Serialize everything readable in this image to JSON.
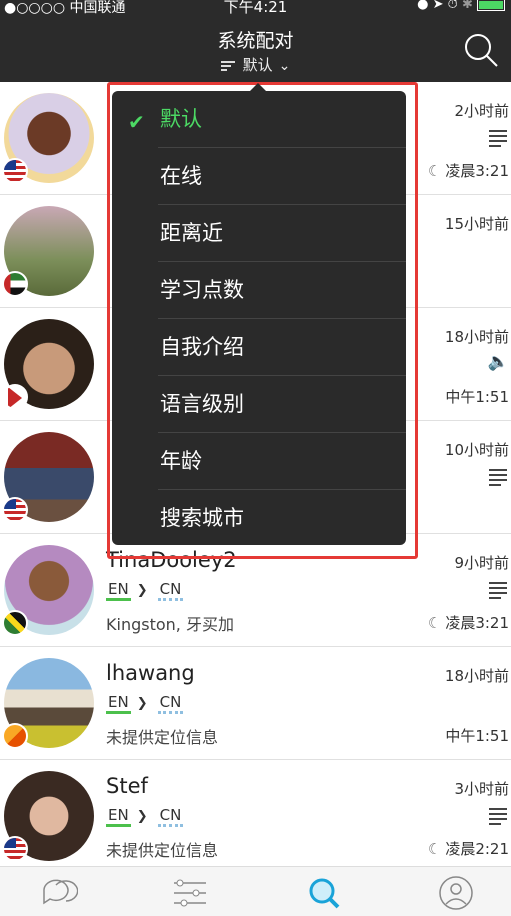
{
  "status_bar": {
    "carrier": "●○○○○ 中国联通",
    "time": "下午4:21",
    "icons": [
      "orientation-lock-icon",
      "location-icon",
      "alarm-icon",
      "bluetooth-icon",
      "battery-icon"
    ]
  },
  "nav": {
    "title": "系统配对",
    "sort_label": "默认",
    "search_icon": "search-icon"
  },
  "dropdown": {
    "selected": "默认",
    "options": [
      "默认",
      "在线",
      "距离近",
      "学习点数",
      "自我介绍",
      "语言级别",
      "年龄",
      "搜索城市"
    ]
  },
  "users": [
    {
      "when": "2小时前",
      "local_time": "凌晨3:21",
      "flag": "US",
      "icon": "note-icon"
    },
    {
      "when": "15小时前",
      "local_time": "",
      "flag": "AE",
      "icon": ""
    },
    {
      "when": "18小时前",
      "local_time": "中午1:51",
      "flag": "NP",
      "icon": "speaker-icon"
    },
    {
      "when": "10小时前",
      "local_time": "",
      "flag": "US",
      "icon": "note-icon"
    },
    {
      "name": "TinaDooley2",
      "native": "EN",
      "learning": "CN",
      "location": "Kingston, 牙买加",
      "when": "9小时前",
      "local_time": "凌晨3:21",
      "flag": "JM",
      "icon": "note-icon"
    },
    {
      "name": "lhawang",
      "native": "EN",
      "learning": "CN",
      "location": "未提供定位信息",
      "when": "18小时前",
      "local_time": "中午1:51",
      "flag": "BT",
      "icon": ""
    },
    {
      "name": "Stef",
      "native": "EN",
      "learning": "CN",
      "location": "未提供定位信息",
      "when": "3小时前",
      "local_time": "凌晨2:21",
      "flag": "US",
      "icon": "note-icon"
    }
  ],
  "tabs": [
    "chat-tab-icon",
    "moments-tab-icon",
    "search-tab-icon",
    "profile-tab-icon"
  ],
  "colors": {
    "accent": "#4cd964",
    "tab_active": "#1aa3d8",
    "highlight_frame": "#e53935"
  }
}
